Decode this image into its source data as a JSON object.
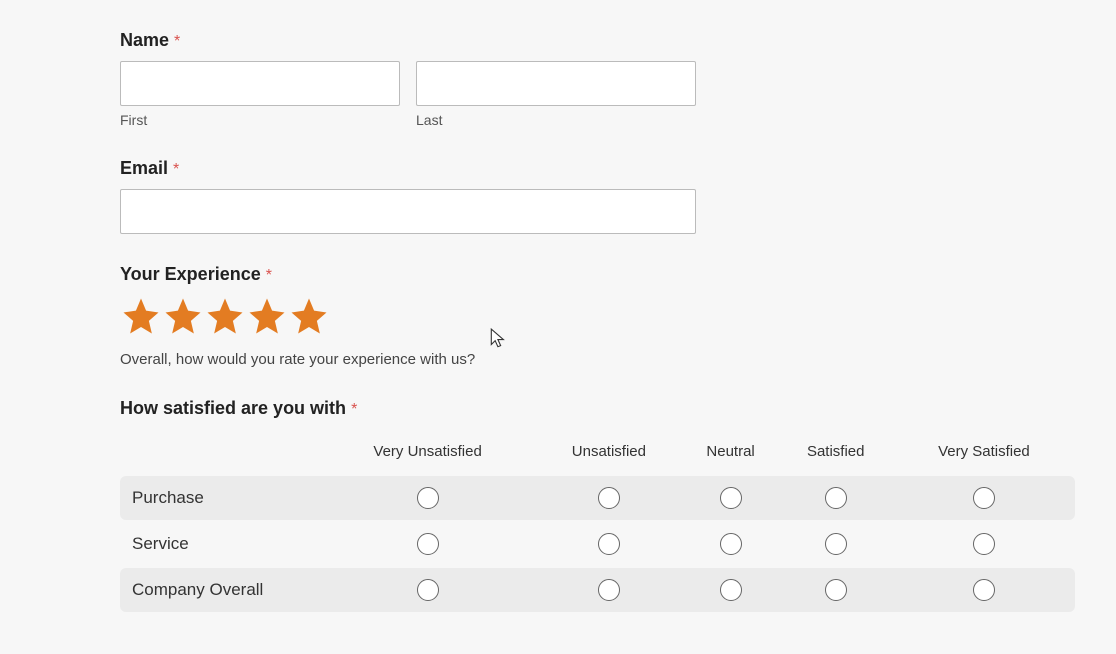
{
  "name_section": {
    "label": "Name",
    "required": "*",
    "first_sublabel": "First",
    "last_sublabel": "Last",
    "first_value": "",
    "last_value": ""
  },
  "email_section": {
    "label": "Email",
    "required": "*",
    "value": ""
  },
  "experience_section": {
    "label": "Your Experience",
    "required": "*",
    "help_text": "Overall, how would you rate your experience with us?",
    "rating_value": 5,
    "star_color": "#E37C22"
  },
  "likert_section": {
    "label": "How satisfied are you with",
    "required": "*",
    "columns": [
      "Very Unsatisfied",
      "Unsatisfied",
      "Neutral",
      "Satisfied",
      "Very Satisfied"
    ],
    "rows": [
      "Purchase",
      "Service",
      "Company Overall"
    ]
  }
}
